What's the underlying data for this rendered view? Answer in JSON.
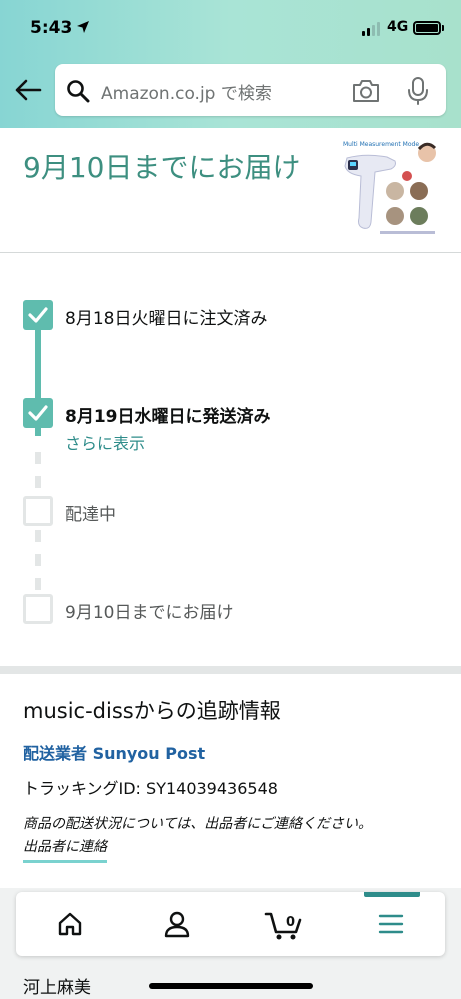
{
  "status_bar": {
    "time": "5:43",
    "network": "4G",
    "icons": [
      "location-arrow-icon",
      "signal-icon",
      "battery-icon"
    ]
  },
  "search": {
    "placeholder": "Amazon.co.jp で検索",
    "icons": [
      "back-arrow-icon",
      "search-icon",
      "camera-icon",
      "microphone-icon"
    ]
  },
  "delivery": {
    "title": "9月10日までにお届け",
    "product_image": "thermometer-product-image"
  },
  "timeline": {
    "steps": [
      {
        "label": "8月18日火曜日に注文済み",
        "completed": true
      },
      {
        "label": "8月19日水曜日に発送済み",
        "completed": true,
        "current": true
      },
      {
        "label": "配達中",
        "completed": false
      },
      {
        "label": "9月10日までにお届け",
        "completed": false
      }
    ],
    "more_link": "さらに表示"
  },
  "tracking": {
    "title": "music-dissからの追跡情報",
    "carrier": "配送業者 Sunyou Post",
    "tracking_id": "トラッキングID: SY14039436548",
    "note": "商品の配送状況については、出品者にご連絡ください。",
    "contact_link": "出品者に連絡"
  },
  "bottom_nav": {
    "items": [
      {
        "name": "home",
        "icon": "home-icon"
      },
      {
        "name": "account",
        "icon": "account-icon"
      },
      {
        "name": "cart",
        "icon": "cart-icon",
        "count": "0"
      },
      {
        "name": "menu",
        "icon": "menu-icon",
        "active": true
      }
    ],
    "user_name": "河上麻美"
  },
  "colors": {
    "accent": "#5fbcae",
    "title_teal": "#3d8f80",
    "link_teal": "#2e8c8a",
    "carrier_blue": "#2162a1",
    "header_gradient_start": "#87d5d3",
    "header_gradient_end": "#a8e1cc"
  }
}
